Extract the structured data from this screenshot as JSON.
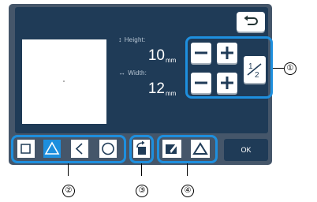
{
  "size": {
    "height_label": "Height:",
    "height_value": "10",
    "height_unit": "mm",
    "width_label": "Width:",
    "width_value": "12",
    "width_unit": "mm"
  },
  "buttons": {
    "ok_label": "OK",
    "ratio_label": "1/2"
  },
  "shapes": [
    {
      "name": "square",
      "active": false
    },
    {
      "name": "triangle",
      "active": true
    },
    {
      "name": "chevron",
      "active": false
    },
    {
      "name": "circle",
      "active": false
    }
  ],
  "callouts": {
    "c1": "①",
    "c2": "②",
    "c3": "③",
    "c4": "④"
  },
  "icons": [
    "back-arrow-icon",
    "minus-icon",
    "plus-icon",
    "half-ratio-icon",
    "rotate-icon",
    "pen-icon",
    "triangle-icon"
  ],
  "colors": {
    "highlight": "#1e8fde",
    "screen": "#1f3b57",
    "frame": "#45566a"
  }
}
